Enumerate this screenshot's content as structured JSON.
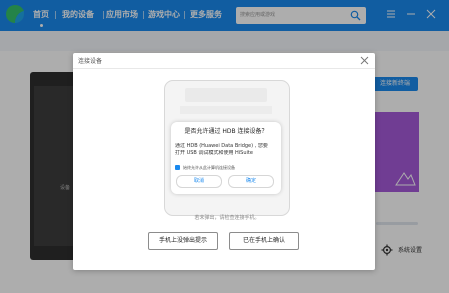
{
  "app": {
    "nav": [
      {
        "label": "首页",
        "active": true
      },
      {
        "label": "我的设备",
        "active": false
      },
      {
        "label": "应用市场",
        "active": false
      },
      {
        "label": "游戏中心",
        "active": false
      },
      {
        "label": "更多服务",
        "active": false
      }
    ],
    "search_placeholder": "搜索应用或游戏",
    "accent_color": "#1a89ee"
  },
  "background": {
    "phone_label": "设备",
    "right_button_label": "连接新终端",
    "settings_label": "系统设置"
  },
  "dialog": {
    "title": "连接设备",
    "card": {
      "title": "是否允许通过 HDB 连接设备？",
      "body_lines": [
        "通过 HDB (Huawei Data Bridge) , 您要",
        "打开 USB 调试模式和使用 HiSuite"
      ],
      "checkbox_label": "始终允许从此计算机连接设备",
      "cancel_label": "取消",
      "confirm_label": "确定"
    },
    "hint": "若未弹出，请检查连接手机。",
    "button_no_prompt": "手机上没弹出提示",
    "button_confirmed": "已在手机上确认"
  }
}
